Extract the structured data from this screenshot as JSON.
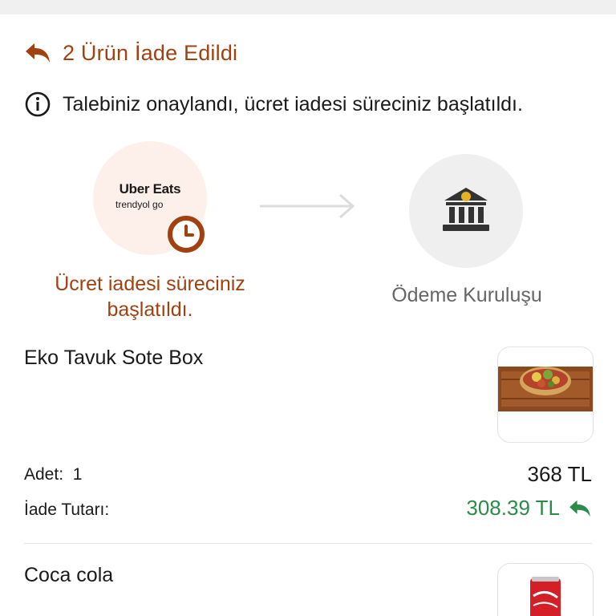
{
  "header": {
    "title": "2 Ürün İade Edildi",
    "back_icon": "reply-arrow-icon",
    "accent_color": "#a1410f"
  },
  "notice": {
    "icon": "info-circle-icon",
    "text": "Talebiniz onaylandı, ücret iadesi süreciniz başlatıldı."
  },
  "progress": {
    "from": {
      "logo_line1": "Uber Eats",
      "logo_line2": "trendyol go",
      "badge_icon": "clock-icon",
      "label": "Ücret iadesi süreciniz başlatıldı."
    },
    "arrow_icon": "arrow-right-icon",
    "to": {
      "icon": "bank-icon",
      "label": "Ödeme Kuruluşu"
    }
  },
  "items": [
    {
      "name": "Eko Tavuk Sote Box",
      "qty_label": "Adet:",
      "qty": "1",
      "price": "368 TL",
      "refund_label": "İade Tutarı:",
      "refund_amount": "308.39 TL",
      "refund_color": "#2a8c4a"
    },
    {
      "name": "Coca cola"
    }
  ]
}
